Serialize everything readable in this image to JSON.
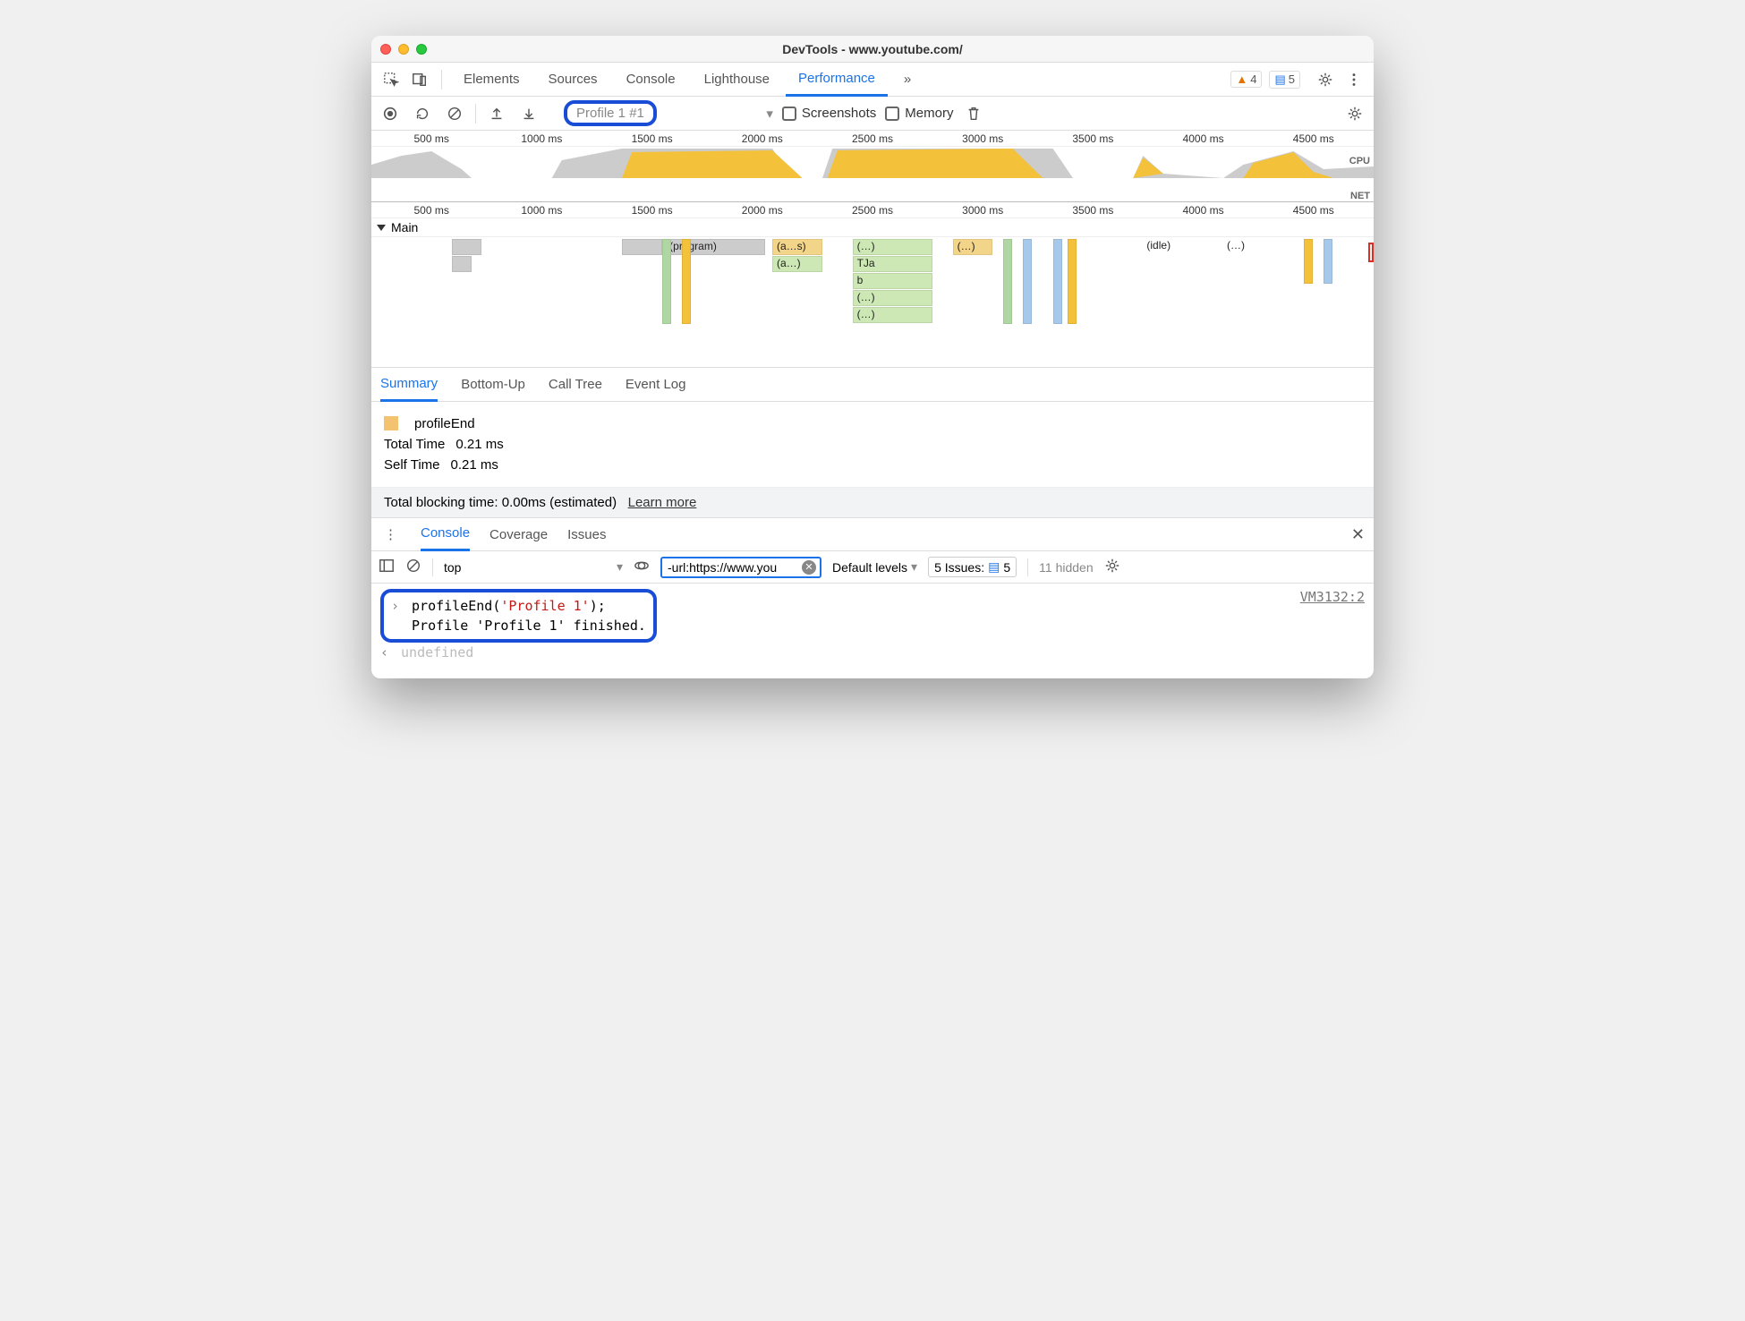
{
  "window": {
    "title": "DevTools - www.youtube.com/"
  },
  "tabs": {
    "elements": "Elements",
    "sources": "Sources",
    "console": "Console",
    "lighthouse": "Lighthouse",
    "performance": "Performance",
    "more": "»"
  },
  "warning_count": "4",
  "message_count": "5",
  "toolbar": {
    "profile_label": "Profile 1 #1",
    "screenshots": "Screenshots",
    "memory": "Memory"
  },
  "ruler_ticks": [
    "500 ms",
    "1000 ms",
    "1500 ms",
    "2000 ms",
    "2500 ms",
    "3000 ms",
    "3500 ms",
    "4000 ms",
    "4500 ms"
  ],
  "overview": {
    "cpu_label": "CPU",
    "net_label": "NET"
  },
  "main_track": "Main",
  "flame_labels": {
    "program": "(program)",
    "as": "(a…s)",
    "a": "(a…)",
    "dots": "(…)",
    "tja": "TJa",
    "b": "b",
    "idle": "(idle)"
  },
  "perf_tabs": {
    "summary": "Summary",
    "bottom_up": "Bottom-Up",
    "call_tree": "Call Tree",
    "event_log": "Event Log"
  },
  "summary": {
    "name": "profileEnd",
    "total_label": "Total Time",
    "total_value": "0.21 ms",
    "self_label": "Self Time",
    "self_value": "0.21 ms"
  },
  "tbt": {
    "text": "Total blocking time: 0.00ms (estimated)",
    "link": "Learn more"
  },
  "drawer": {
    "console": "Console",
    "coverage": "Coverage",
    "issues": "Issues"
  },
  "console_toolbar": {
    "context": "top",
    "filter": "-url:https://www.you",
    "levels": "Default levels",
    "issues_label": "5 Issues:",
    "issues_count": "5",
    "hidden": "11 hidden"
  },
  "console_output": {
    "cmd_pre": "profileEnd(",
    "cmd_str": "'Profile 1'",
    "cmd_post": ");",
    "result": "Profile 'Profile 1' finished.",
    "source": "VM3132:2",
    "undef": "undefined"
  }
}
